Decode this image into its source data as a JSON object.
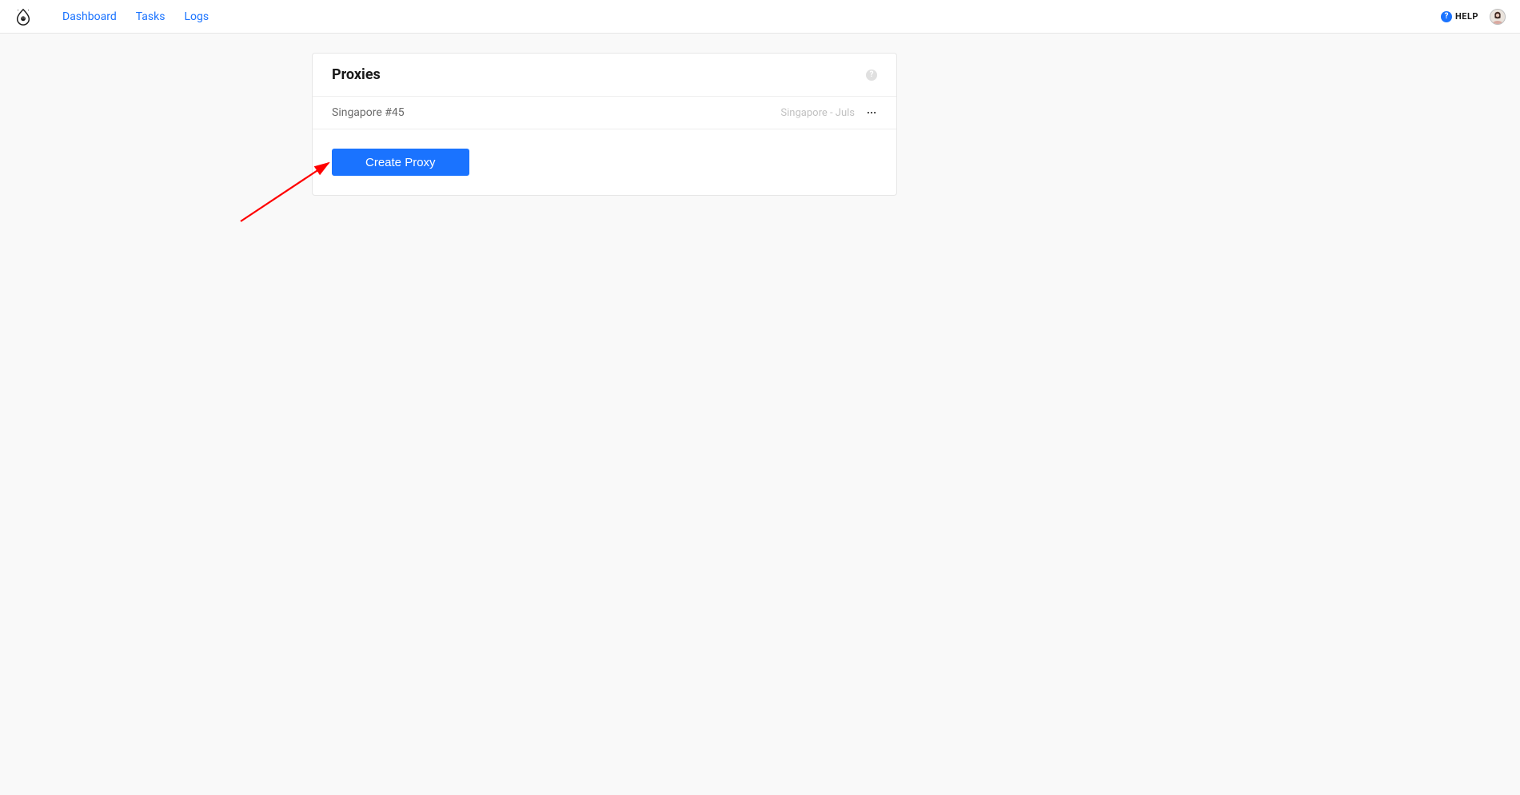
{
  "nav": {
    "links": [
      "Dashboard",
      "Tasks",
      "Logs"
    ],
    "help_label": "HELP"
  },
  "card": {
    "title": "Proxies"
  },
  "proxies": [
    {
      "name": "Singapore #45",
      "meta": "Singapore - Juls"
    }
  ],
  "actions": {
    "create_proxy": "Create Proxy"
  }
}
